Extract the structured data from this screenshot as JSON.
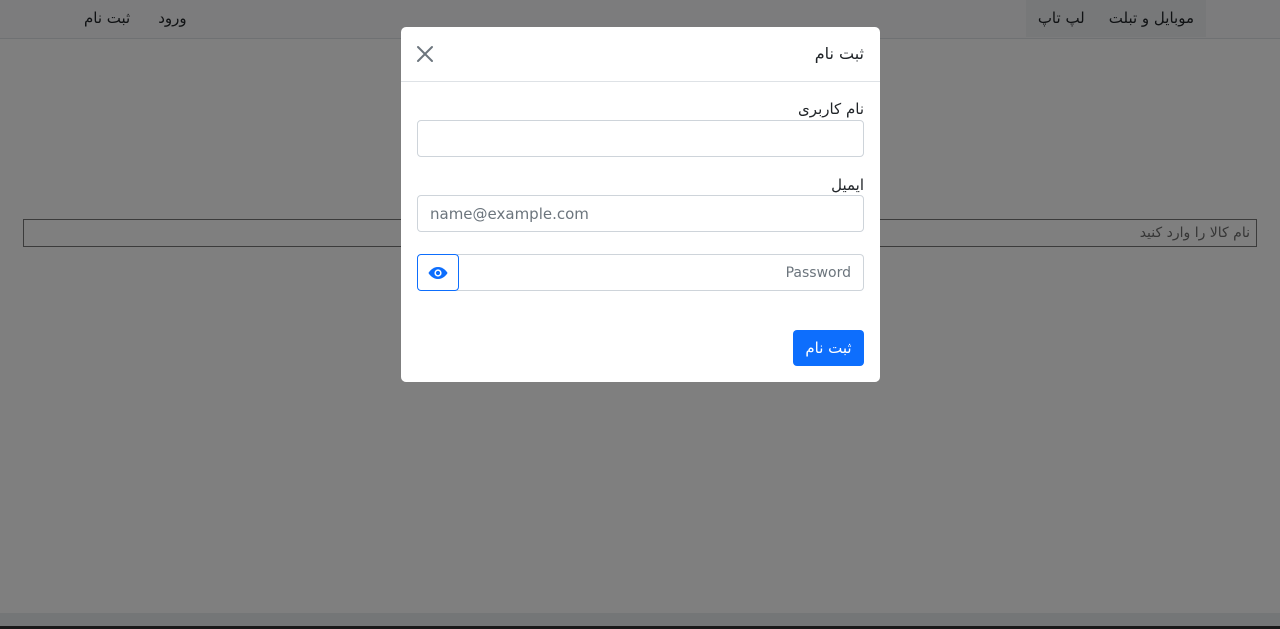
{
  "navbar": {
    "categories": [
      {
        "label": "موبایل و تبلت"
      },
      {
        "label": "لپ تاپ"
      }
    ],
    "login_label": "ورود",
    "register_label": "ثبت نام"
  },
  "search": {
    "placeholder": "نام کالا را وارد کنید"
  },
  "modal": {
    "title": "ثبت نام",
    "username_label": "نام کاربری",
    "username_value": "",
    "email_label": "ایمیل",
    "email_placeholder": "name@example.com",
    "password_placeholder": "Password",
    "submit_label": "ثبت نام",
    "close_icon": "close-icon",
    "toggle_icon": "eye-icon"
  },
  "colors": {
    "primary": "#0d6efd",
    "backdrop": "rgba(0,0,0,0.5)"
  }
}
